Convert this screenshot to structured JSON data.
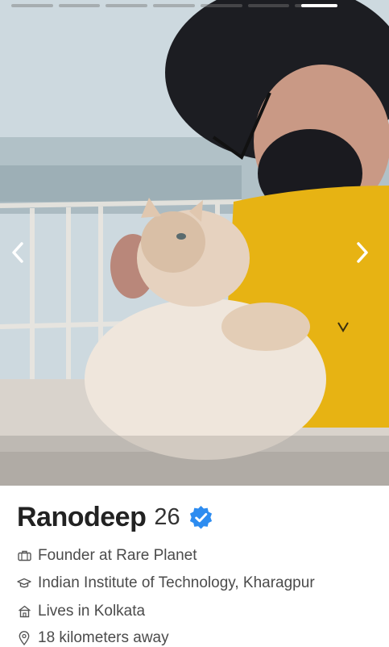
{
  "profile": {
    "name": "Ranodeep",
    "age": "26",
    "verified": true,
    "details": [
      {
        "icon": "briefcase-icon",
        "text": "Founder at Rare Planet"
      },
      {
        "icon": "graduation-cap-icon",
        "text": "Indian Institute of Technology, Kharagpur"
      },
      {
        "icon": "house-icon",
        "text": "Lives in Kolkata"
      },
      {
        "icon": "location-pin-icon",
        "text": "18 kilometers away"
      }
    ]
  },
  "photos": {
    "count": 8,
    "active_index": 7
  },
  "colors": {
    "verified": "#2d8cf0",
    "shirt": "#e7b313",
    "text": "#222222"
  }
}
